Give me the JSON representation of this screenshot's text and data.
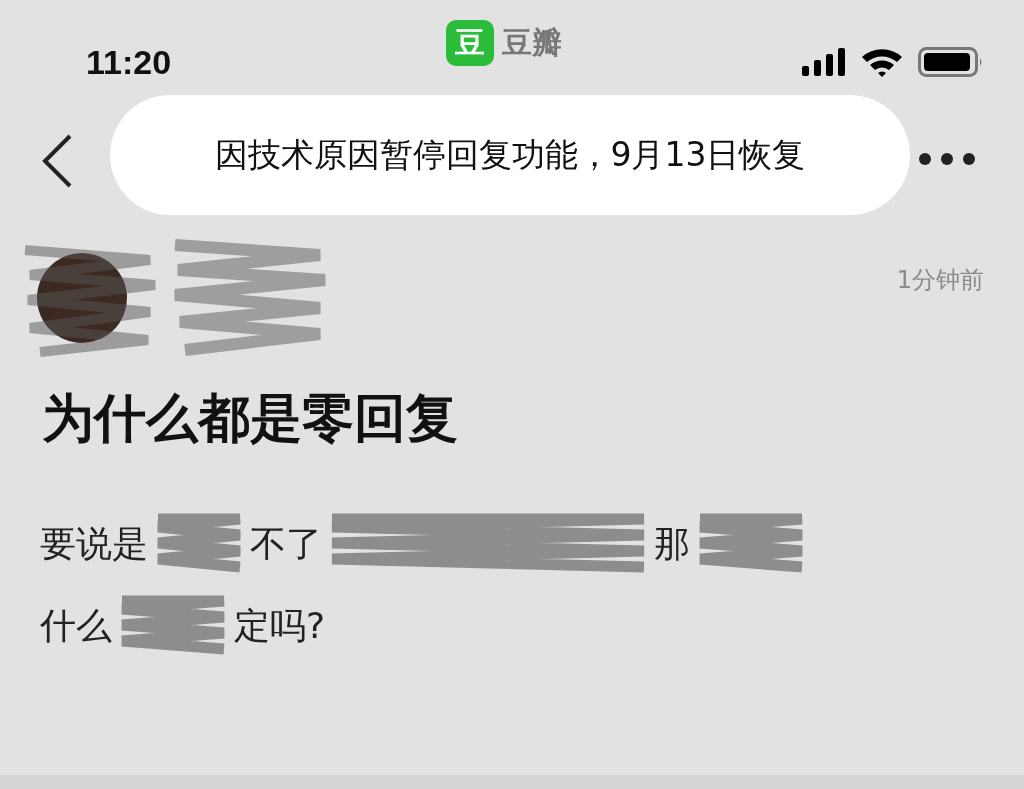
{
  "status_bar": {
    "time": "11:20",
    "app_logo": "豆",
    "app_name": "豆瓣"
  },
  "toast": {
    "text": "因技术原因暂停回复功能，9月13日恢复"
  },
  "post": {
    "timestamp": "1分钟前",
    "title": "为什么都是零回复",
    "body_lines": [
      [
        {
          "kind": "text",
          "text": "要说是"
        },
        {
          "kind": "redacted"
        },
        {
          "kind": "text",
          "text": "不了"
        },
        {
          "kind": "redacted"
        },
        {
          "kind": "text",
          "text": "那"
        },
        {
          "kind": "redacted"
        }
      ],
      [
        {
          "kind": "text",
          "text": "什么"
        },
        {
          "kind": "redacted"
        },
        {
          "kind": "text",
          "text": "定吗?"
        }
      ]
    ]
  }
}
